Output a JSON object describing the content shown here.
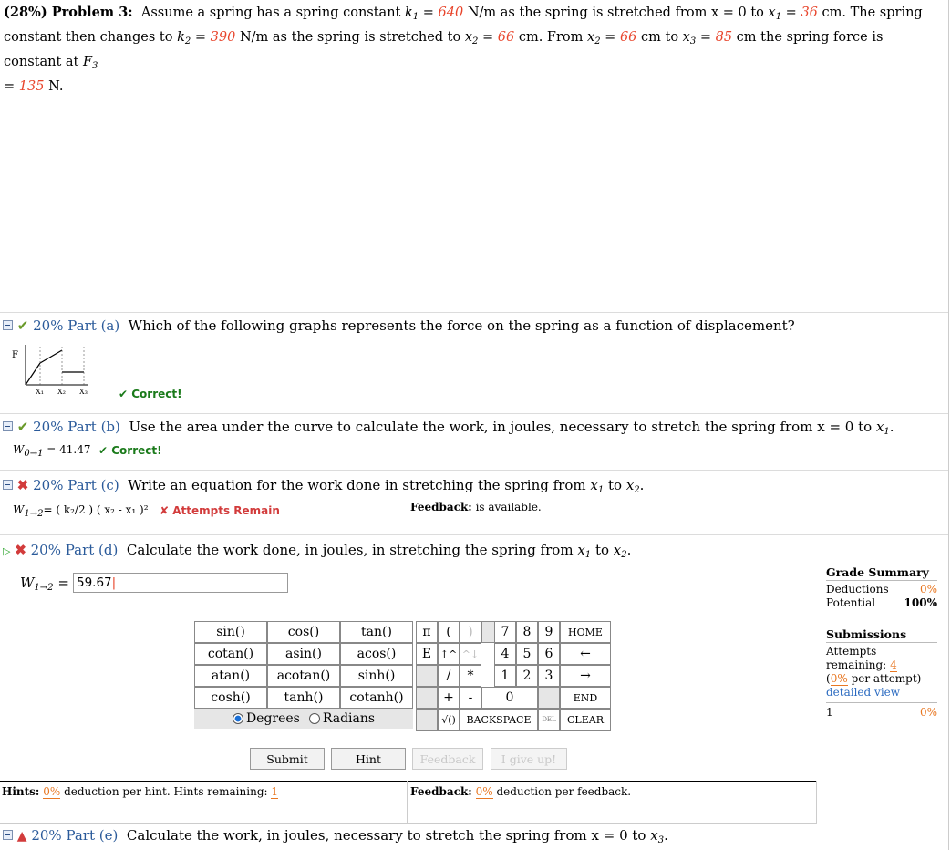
{
  "problem": {
    "label": "(28%) Problem 3:",
    "text_1": "Assume a spring has a spring constant",
    "k1_sym": "k",
    "k1_sub": "1",
    "k1_val": "640",
    "k1_unit": "N/m as the spring is stretched from",
    "x0": "x = 0",
    "to": "to",
    "x1_sym": "x",
    "x1_sub": "1",
    "x1_val": "36",
    "x1_unit": "cm. The spring",
    "text_2": "constant then changes to",
    "k2_sym": "k",
    "k2_sub": "2",
    "k2_val": "390",
    "k2_unit": "N/m as the spring is stretched to",
    "x2_sym": "x",
    "x2_sub": "2",
    "x2_val": "66",
    "x2_unit": "cm. From",
    "x2b_val": "66",
    "cm_to": "cm to",
    "x3_sym": "x",
    "x3_sub": "3",
    "x3_val": "85",
    "x3_unit": "cm the spring force is constant at",
    "F3_sym": "F",
    "F3_sub": "3",
    "F3_val": "135",
    "F3_unit": "N."
  },
  "part_a": {
    "title": "20% Part (a)",
    "question": "Which of the following graphs represents the force on the spring as a function of displacement?",
    "graph_F": "F",
    "graph_x1": "X₁",
    "graph_x2": "X₂",
    "graph_x3": "X₃",
    "status": "✔ Correct!"
  },
  "part_b": {
    "title": "20% Part (b)",
    "question": "Use the area under the curve to calculate the work, in joules, necessary to stretch the spring from",
    "q_from": "x = 0",
    "q_to": "to",
    "q_x": "x",
    "q_sub": "1",
    "answer_sym": "W",
    "answer_sub": "0→1",
    "answer_val": "= 41.47",
    "status": "✔ Correct!"
  },
  "part_c": {
    "title": "20% Part (c)",
    "question": "Write an equation for the work done in stretching the spring from",
    "answer": "= ( k₂/2 ) ( x₂ - x₁ )²",
    "answer_sym": "W",
    "answer_sub": "1→2",
    "status": "✘ Attempts Remain",
    "feedback_label": "Feedback:",
    "feedback_text": "is available."
  },
  "part_d": {
    "title": "20% Part (d)",
    "question": "Calculate the work done, in joules, in stretching the spring from",
    "answer_sym": "W",
    "answer_sub": "1→2",
    "answer_eq": "=",
    "input_value": "59.67"
  },
  "part_e": {
    "title": "20% Part (e)",
    "question": "Calculate the work, in joules, necessary to stretch the spring from",
    "q_from": "x = 0",
    "q_to": "to",
    "q_x": "x",
    "q_sub": "3"
  },
  "keypad": {
    "functions": [
      "sin()",
      "cos()",
      "tan()",
      "cotan()",
      "asin()",
      "acos()",
      "atan()",
      "acotan()",
      "sinh()",
      "cosh()",
      "tanh()",
      "cotanh()"
    ],
    "angle_degrees": "Degrees",
    "angle_radians": "Radians",
    "keys": {
      "pi": "π",
      "lparen": "(",
      "rparen": ")",
      "e": "E",
      "up": "↑^",
      "upr": "^↓",
      "div": "/",
      "mul": "*",
      "plus": "+",
      "minus": "-",
      "sqrt": "√()",
      "backspace": "BACKSPACE",
      "del": "DEL",
      "n7": "7",
      "n8": "8",
      "n9": "9",
      "n4": "4",
      "n5": "5",
      "n6": "6",
      "n1": "1",
      "n2": "2",
      "n3": "3",
      "n0": "0",
      "home": "HOME",
      "left": "←",
      "right": "→",
      "end": "END",
      "clear": "CLEAR"
    }
  },
  "buttons": {
    "submit": "Submit",
    "hint": "Hint",
    "feedback": "Feedback",
    "give_up": "I give up!"
  },
  "hints_bar": {
    "label": "Hints:",
    "pct": "0%",
    "text": "deduction per hint. Hints remaining:",
    "remaining": "1"
  },
  "feedback_bar": {
    "label": "Feedback:",
    "pct": "0%",
    "text": "deduction per feedback."
  },
  "grade_summary": {
    "title": "Grade Summary",
    "deductions_label": "Deductions",
    "deductions_val": "0%",
    "potential_label": "Potential",
    "potential_val": "100%",
    "submissions_title": "Submissions",
    "attempts_label": "Attempts remaining:",
    "attempts_val": "4",
    "per_attempt_pct": "0%",
    "per_attempt_text": "per attempt)",
    "detailed_view": "detailed view",
    "row_num": "1",
    "row_val": "0%"
  },
  "colors": {
    "given_value": "#e8442b",
    "part_header": "#2a5a9a",
    "correct": "#1a7a1a",
    "error": "#d23b3b",
    "accent_orange": "#e87722"
  }
}
